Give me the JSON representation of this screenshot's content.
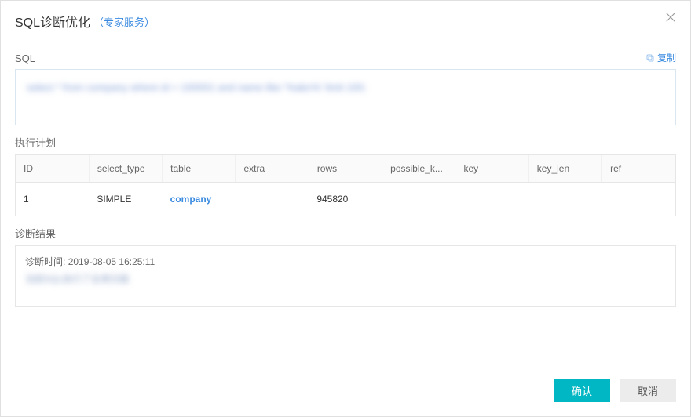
{
  "header": {
    "title": "SQL诊断优化",
    "subtitle": "（专家服务）"
  },
  "sections": {
    "sql_label": "SQL",
    "copy_label": "复制",
    "sql_content_redacted": "select * from company where id = 100001 and name like '%abc%' limit 100;",
    "exec_plan_label": "执行计划",
    "diag_result_label": "诊断结果",
    "diag_time_prefix": "诊断时间:",
    "diag_time": "2019-08-05 16:25:11",
    "diag_body_redacted": "当前SQL执行了全表扫描"
  },
  "table": {
    "columns": [
      "ID",
      "select_type",
      "table",
      "extra",
      "rows",
      "possible_k...",
      "key",
      "key_len",
      "ref"
    ],
    "rows": [
      {
        "id": "1",
        "select_type": "SIMPLE",
        "table": "company",
        "extra": "",
        "rows": "945820",
        "possible_keys": "",
        "key": "",
        "key_len": "",
        "ref": ""
      }
    ]
  },
  "footer": {
    "ok": "确认",
    "cancel": "取消"
  }
}
